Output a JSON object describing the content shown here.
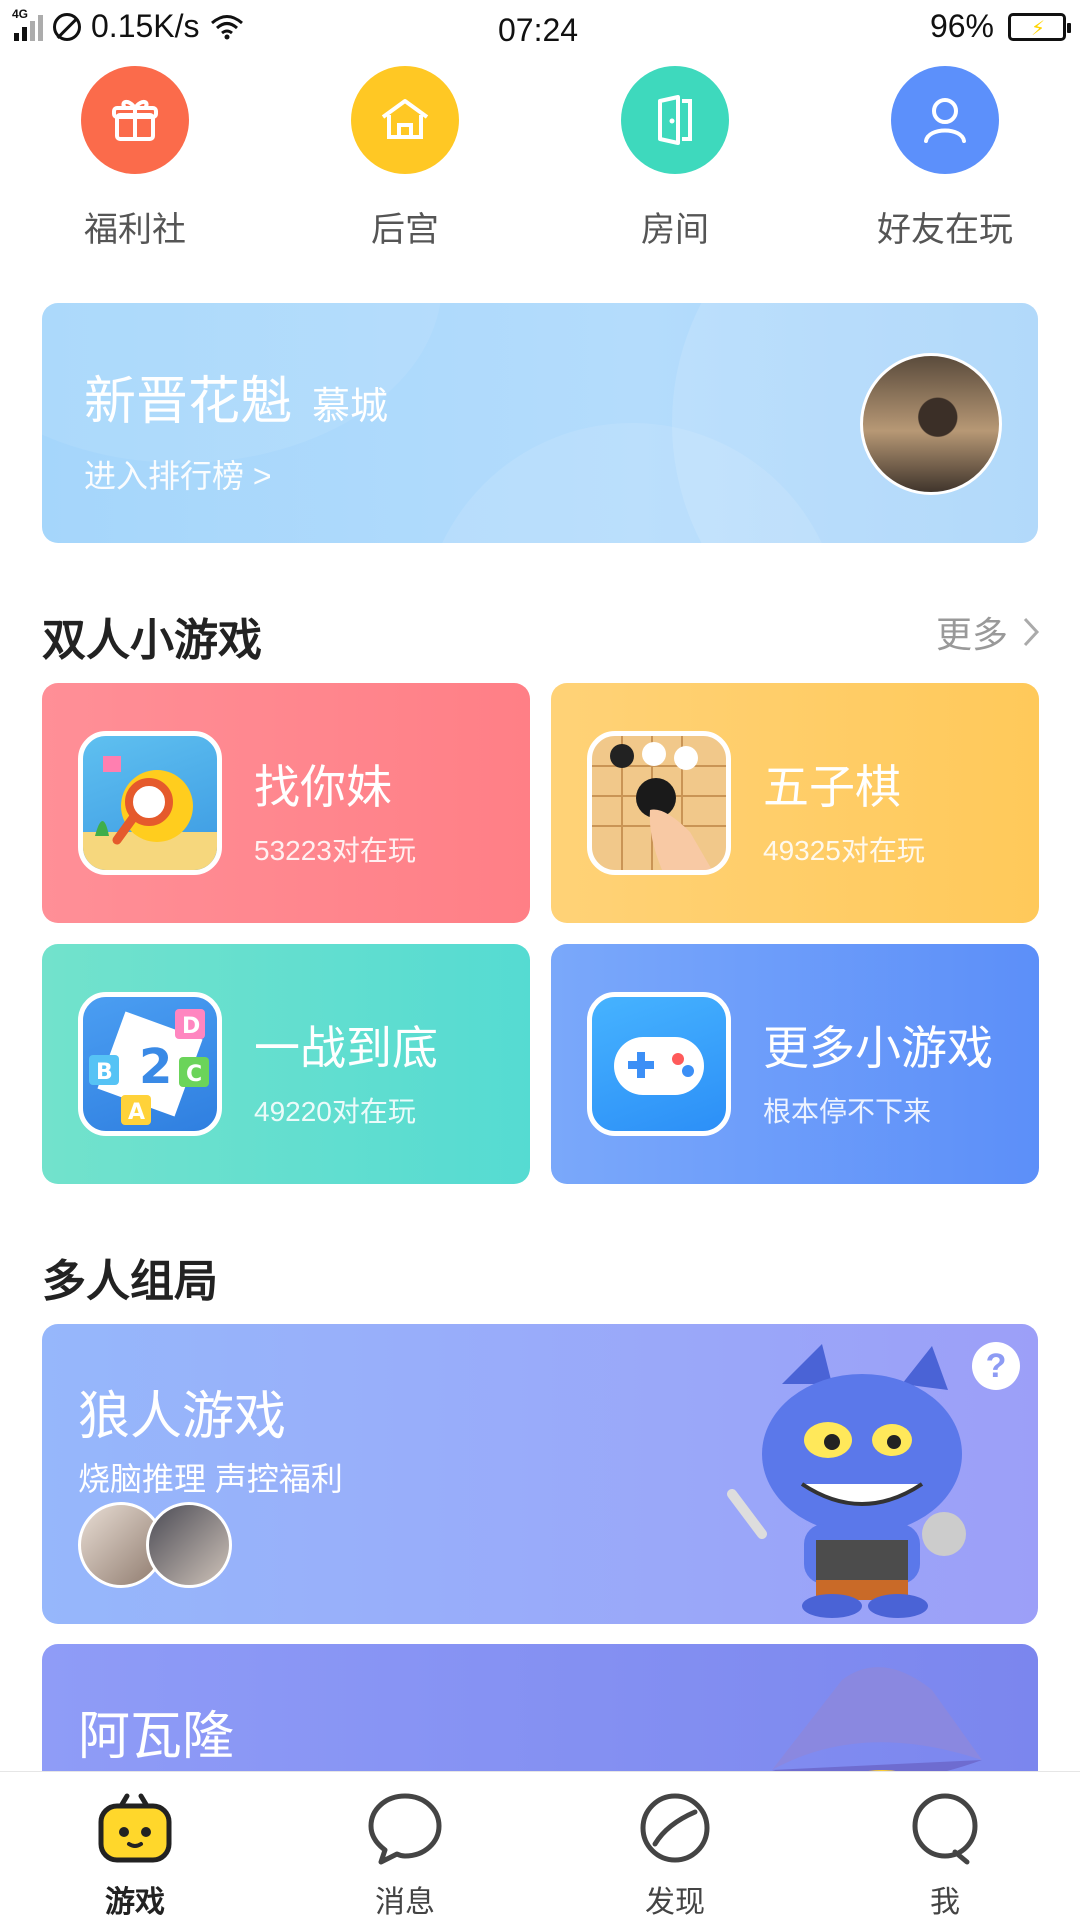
{
  "status_bar": {
    "network": "4G",
    "speed": "0.15K/s",
    "time": "07:24",
    "battery": "96%"
  },
  "quick_nav": [
    {
      "label": "福利社",
      "icon": "gift-icon",
      "color": "#fb6b4b"
    },
    {
      "label": "后宫",
      "icon": "palace-icon",
      "color": "#ffc824"
    },
    {
      "label": "房间",
      "icon": "door-icon",
      "color": "#3ed9bd"
    },
    {
      "label": "好友在玩",
      "icon": "person-icon",
      "color": "#5c90fb"
    }
  ],
  "rank_banner": {
    "title": "新晋花魁",
    "user": "慕城",
    "link": "进入排行榜 >"
  },
  "duo_section": {
    "title": "双人小游戏",
    "more": "更多",
    "games": [
      {
        "name": "找你妹",
        "sub": "53223对在玩"
      },
      {
        "name": "五子棋",
        "sub": "49325对在玩"
      },
      {
        "name": "一战到底",
        "sub": "49220对在玩"
      },
      {
        "name": "更多小游戏",
        "sub": "根本停不下来"
      }
    ]
  },
  "multi_section": {
    "title": "多人组局",
    "werewolf": {
      "title": "狼人游戏",
      "sub": "烧脑推理 声控福利",
      "help": "?"
    },
    "avalon": {
      "title": "阿瓦隆"
    }
  },
  "tab_bar": [
    {
      "label": "游戏",
      "icon": "game-icon",
      "active": true
    },
    {
      "label": "消息",
      "icon": "message-icon",
      "active": false
    },
    {
      "label": "发现",
      "icon": "discover-icon",
      "active": false
    },
    {
      "label": "我",
      "icon": "profile-icon",
      "active": false
    }
  ]
}
